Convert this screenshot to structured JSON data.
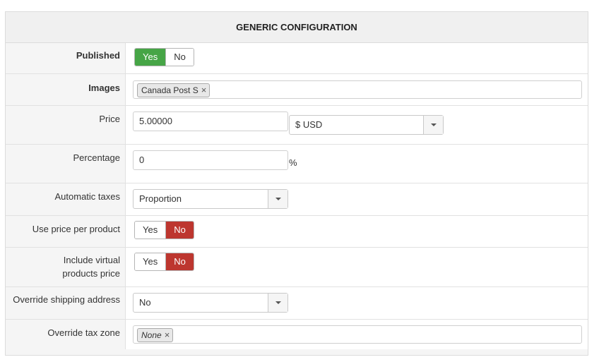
{
  "panel": {
    "title": "GENERIC CONFIGURATION"
  },
  "fields": {
    "published": {
      "label": "Published",
      "yes": "Yes",
      "no": "No",
      "value": "Yes"
    },
    "images": {
      "label": "Images",
      "tag": "Canada Post S",
      "remove": "×"
    },
    "price": {
      "label": "Price",
      "value": "5.00000",
      "currency": "$ USD"
    },
    "percentage": {
      "label": "Percentage",
      "value": "0",
      "unit": "%"
    },
    "automatic_taxes": {
      "label": "Automatic taxes",
      "value": "Proportion"
    },
    "use_price_per_product": {
      "label": "Use price per product",
      "yes": "Yes",
      "no": "No",
      "value": "No"
    },
    "include_virtual": {
      "label": "Include virtual products price",
      "yes": "Yes",
      "no": "No",
      "value": "No"
    },
    "override_shipping": {
      "label": "Override shipping address",
      "value": "No"
    },
    "override_tax_zone": {
      "label": "Override tax zone",
      "tag": "None",
      "remove": "×"
    }
  },
  "colors": {
    "yes_active": "#46a546",
    "no_active": "#bd362f"
  }
}
